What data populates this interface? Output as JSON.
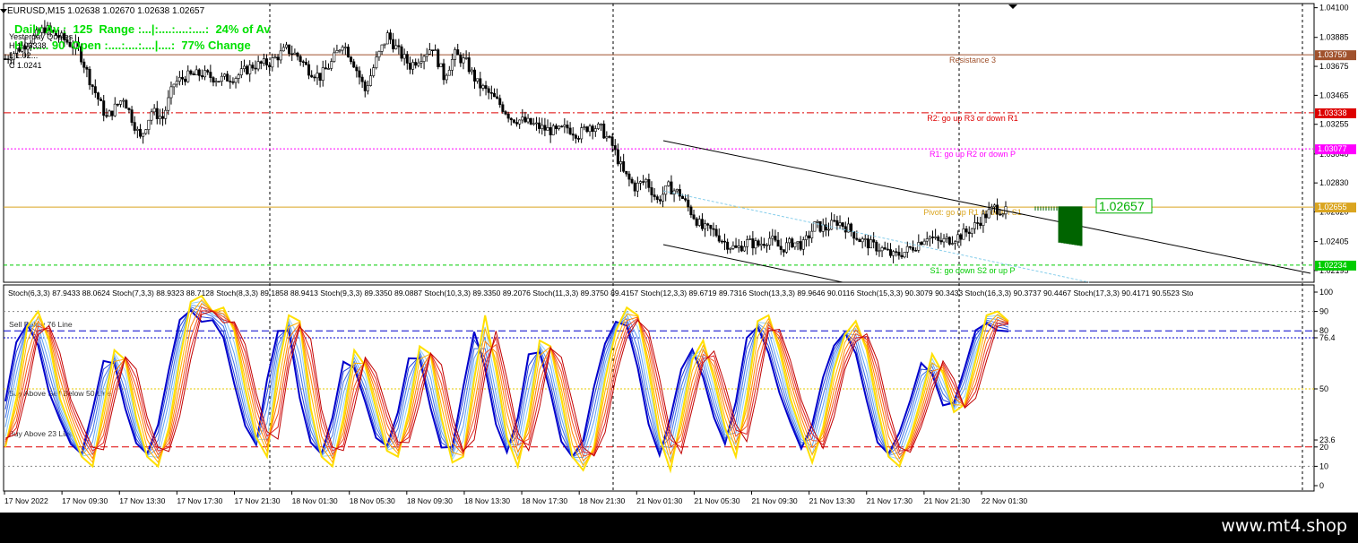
{
  "header": {
    "symbol_line": "EURUSD,M15  1.02638 1.02670 1.02638 1.02657",
    "daily_line1": "Daily Av :  125  Range :...|:....:....:....:  24% of Av",
    "daily_line2": "H  ...... 90  Open :....:....:....|....:  77% Change",
    "yesterday_label": "Yesterday Quotes",
    "yesterday_h": "H 1.03338",
    "yesterday_l": "L 1.02...",
    "yesterday_c": "C 1.0241"
  },
  "colors": {
    "resistance3": "#a0522d",
    "r2": "#dd0000",
    "r1": "#ff00ff",
    "pivot": "#daa520",
    "s1": "#00cc00",
    "bull": "#000000",
    "projection": "#006400",
    "price_box": "#00b000",
    "footer": "#000000"
  },
  "price_axis": {
    "min": 1.0211,
    "max": 1.0413,
    "ticks": [
      "1.04100",
      "1.03885",
      "1.03675",
      "1.03465",
      "1.03255",
      "1.03040",
      "1.02830",
      "1.02620",
      "1.02405",
      "1.02195"
    ]
  },
  "levels": [
    {
      "key": "resistance3",
      "label": "Resistance 3",
      "price": 1.03759,
      "badge": "1.03759",
      "style": "solid"
    },
    {
      "key": "r2",
      "label": "R2: go up R3 or down R1",
      "price": 1.03338,
      "badge": "1.03338",
      "style": "dashdot"
    },
    {
      "key": "r1",
      "label": "R1: go up R2 or down P",
      "price": 1.03077,
      "badge": "1.03077",
      "style": "dotted"
    },
    {
      "key": "pivot",
      "label": "Pivot: go up R1 or down S1",
      "price": 1.02655,
      "badge": "1.02655",
      "style": "solid"
    },
    {
      "key": "s1",
      "label": "S1: go down S2 or up P",
      "price": 1.02234,
      "badge": "1.02234",
      "style": "dashed"
    }
  ],
  "current_price": "1.02657",
  "stoch_header": "Stoch(6,3,3) 87.9433 88.0624   Stoch(7,3,3) 88.9323 88.7128   Stoch(8,3,3) 89.1858 88.9413   Stoch(9,3,3) 89.3350 89.0887   Stoch(10,3,3) 89.3350 89.2076   Stoch(11,3,3) 89.3750 89.4157   Stoch(12,3,3) 89.6719 89.7316   Stoch(13,3,3) 89.9646 90.0116   Stoch(15,3,3) 90.3079 90.3433   Stoch(16,3,3) 90.3737 90.4467   Stoch(17,3,3) 90.4171 90.5523   Sto",
  "stoch_axis": {
    "ticks": [
      "100",
      "90",
      "80",
      "76.4",
      "50",
      "23.6",
      "20",
      "10",
      "0"
    ]
  },
  "stoch_labels": {
    "sell_below": "Sell Below 76 Line",
    "buy_sell_50": "Buy Above Sell Below 50 Line",
    "buy_above_23": "Buy Above 23 Line"
  },
  "time_axis": [
    "17 Nov 2022",
    "17 Nov 09:30",
    "17 Nov 13:30",
    "17 Nov 17:30",
    "17 Nov 21:30",
    "18 Nov 01:30",
    "18 Nov 05:30",
    "18 Nov 09:30",
    "18 Nov 13:30",
    "18 Nov 17:30",
    "18 Nov 21:30",
    "21 Nov 01:30",
    "21 Nov 05:30",
    "21 Nov 09:30",
    "21 Nov 13:30",
    "21 Nov 17:30",
    "21 Nov 21:30",
    "22 Nov 01:30"
  ],
  "watermark": "www.mt4.shop",
  "chart_data": {
    "type": "candlestick",
    "symbol": "EURUSD",
    "timeframe": "M15",
    "ylim": [
      1.0211,
      1.0413
    ],
    "close_path": [
      [
        0,
        1.0373
      ],
      [
        8,
        1.0385
      ],
      [
        14,
        1.0395
      ],
      [
        20,
        1.0388
      ],
      [
        26,
        1.038
      ],
      [
        30,
        1.0358
      ],
      [
        36,
        1.033
      ],
      [
        42,
        1.0345
      ],
      [
        48,
        1.0315
      ],
      [
        52,
        1.0335
      ],
      [
        56,
        1.033
      ],
      [
        60,
        1.0355
      ],
      [
        64,
        1.036
      ],
      [
        70,
        1.0362
      ],
      [
        76,
        1.0358
      ],
      [
        82,
        1.036
      ],
      [
        88,
        1.0368
      ],
      [
        94,
        1.037
      ],
      [
        100,
        1.038
      ],
      [
        104,
        1.0375
      ],
      [
        108,
        1.0365
      ],
      [
        112,
        1.036
      ],
      [
        116,
        1.037
      ],
      [
        120,
        1.0385
      ],
      [
        124,
        1.037
      ],
      [
        128,
        1.035
      ],
      [
        132,
        1.0372
      ],
      [
        136,
        1.039
      ],
      [
        140,
        1.0378
      ],
      [
        144,
        1.0368
      ],
      [
        148,
        1.0375
      ],
      [
        152,
        1.0382
      ],
      [
        156,
        1.036
      ],
      [
        160,
        1.0376
      ],
      [
        164,
        1.037
      ],
      [
        168,
        1.0355
      ],
      [
        172,
        1.0348
      ],
      [
        176,
        1.034
      ],
      [
        180,
        1.033
      ],
      [
        184,
        1.0328
      ],
      [
        188,
        1.0325
      ],
      [
        192,
        1.0322
      ],
      [
        196,
        1.032
      ],
      [
        200,
        1.0323
      ],
      [
        204,
        1.0318
      ],
      [
        208,
        1.0325
      ],
      [
        212,
        1.0322
      ],
      [
        216,
        1.031
      ],
      [
        220,
        1.029
      ],
      [
        224,
        1.028
      ],
      [
        228,
        1.0285
      ],
      [
        232,
        1.027
      ],
      [
        236,
        1.028
      ],
      [
        240,
        1.0275
      ],
      [
        244,
        1.0262
      ],
      [
        248,
        1.025
      ],
      [
        252,
        1.0248
      ],
      [
        256,
        1.024
      ],
      [
        260,
        1.0235
      ],
      [
        264,
        1.024
      ],
      [
        268,
        1.0238
      ],
      [
        272,
        1.0243
      ],
      [
        276,
        1.0235
      ],
      [
        280,
        1.024
      ],
      [
        284,
        1.0238
      ],
      [
        288,
        1.0252
      ],
      [
        292,
        1.025
      ],
      [
        296,
        1.0255
      ],
      [
        300,
        1.025
      ],
      [
        304,
        1.0242
      ],
      [
        308,
        1.0238
      ],
      [
        312,
        1.0235
      ],
      [
        316,
        1.023
      ],
      [
        320,
        1.0233
      ],
      [
        324,
        1.0238
      ],
      [
        328,
        1.0245
      ],
      [
        332,
        1.024
      ],
      [
        336,
        1.0242
      ],
      [
        340,
        1.0245
      ],
      [
        344,
        1.025
      ],
      [
        348,
        1.0258
      ],
      [
        352,
        1.0265
      ],
      [
        356,
        1.0262
      ]
    ],
    "bar_count": 357,
    "projection": {
      "from": 1.0266,
      "to": 1.024
    },
    "channel": {
      "upper": [
        [
          1.0311,
          0
        ],
        [
          1.0225,
          1
        ]
      ],
      "lower": [
        [
          1.0246,
          0
        ],
        [
          1.0216,
          1
        ]
      ]
    },
    "levels_ref": "levels",
    "current": 1.02657
  },
  "stoch_data": {
    "type": "line",
    "ylim": [
      0,
      100
    ],
    "lines": [
      76.4,
      50,
      23.6
    ],
    "series_count": 11,
    "base_series": [
      20,
      45,
      82,
      90,
      75,
      45,
      30,
      15,
      10,
      40,
      70,
      65,
      35,
      15,
      10,
      30,
      65,
      95,
      98,
      90,
      92,
      80,
      50,
      25,
      15,
      60,
      88,
      85,
      40,
      15,
      10,
      35,
      70,
      62,
      40,
      18,
      15,
      38,
      72,
      68,
      35,
      12,
      15,
      55,
      88,
      60,
      25,
      10,
      35,
      75,
      72,
      45,
      15,
      8,
      20,
      55,
      80,
      92,
      88,
      60,
      25,
      8,
      35,
      65,
      75,
      55,
      30,
      15,
      45,
      85,
      88,
      70,
      45,
      28,
      12,
      30,
      60,
      78,
      85,
      70,
      40,
      15,
      10,
      25,
      45,
      68,
      58,
      38,
      42,
      65,
      88,
      90,
      85
    ]
  }
}
